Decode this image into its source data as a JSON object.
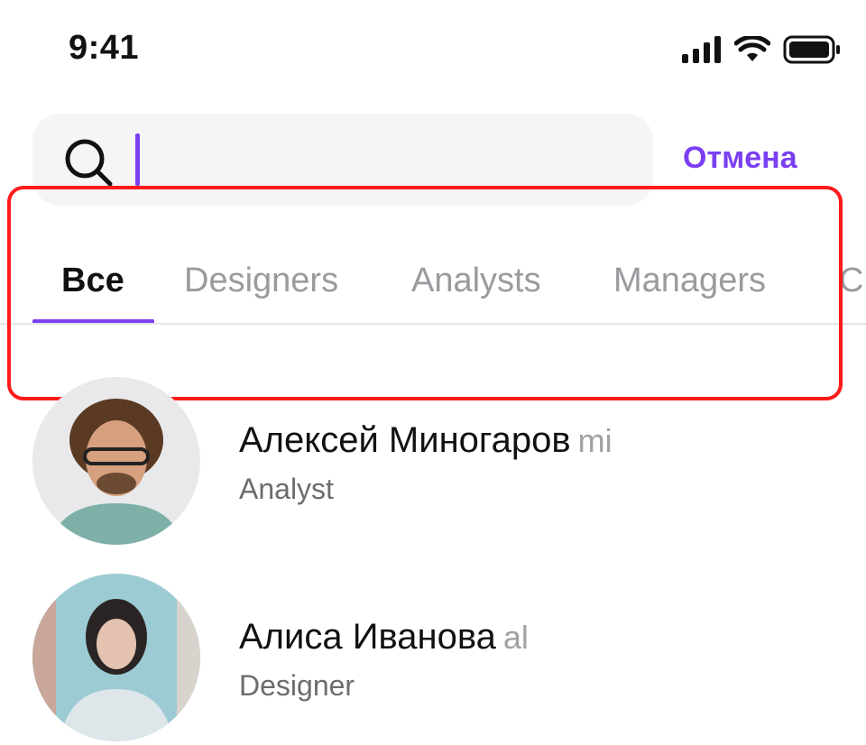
{
  "status_bar": {
    "time": "9:41"
  },
  "search": {
    "placeholder": ""
  },
  "cancel_label": "Отмена",
  "tabs": [
    {
      "label": "Все",
      "active": true
    },
    {
      "label": "Designers",
      "active": false
    },
    {
      "label": "Analysts",
      "active": false
    },
    {
      "label": "Managers",
      "active": false
    },
    {
      "label": "C",
      "active": false
    }
  ],
  "contacts": [
    {
      "name": "Алексей Миногаров",
      "handle": "mi",
      "role": "Analyst"
    },
    {
      "name": "Алиса Иванова",
      "handle": "al",
      "role": "Designer"
    }
  ],
  "colors": {
    "accent": "#7B3FF2",
    "highlight": "#FF1A1A"
  }
}
